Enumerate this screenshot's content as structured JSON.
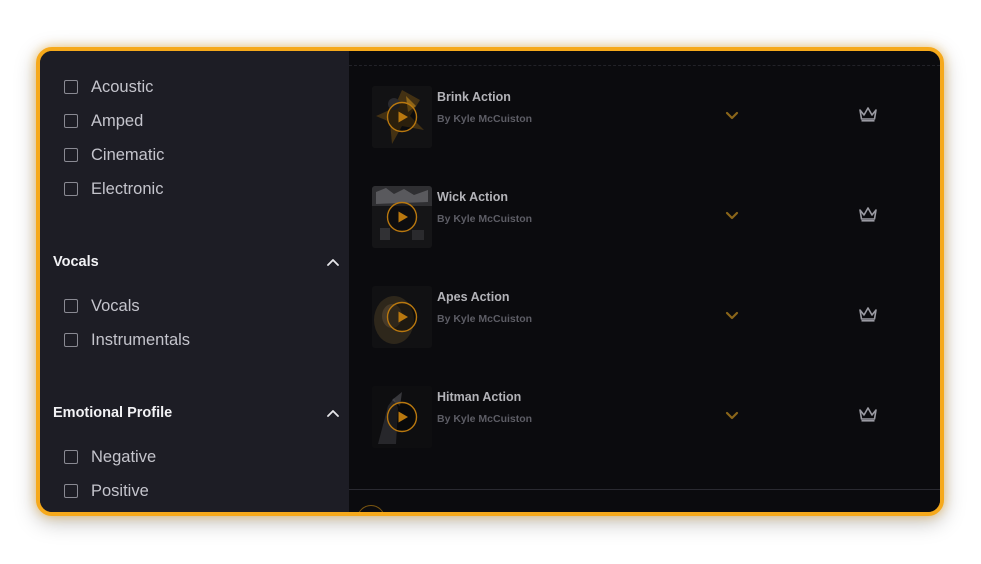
{
  "filters": {
    "mood_items": [
      {
        "label": "Acoustic"
      },
      {
        "label": "Amped"
      },
      {
        "label": "Cinematic"
      },
      {
        "label": "Electronic"
      }
    ],
    "vocals": {
      "title": "Vocals",
      "items": [
        {
          "label": "Vocals"
        },
        {
          "label": "Instrumentals"
        }
      ]
    },
    "emotional_profile": {
      "title": "Emotional Profile",
      "items": [
        {
          "label": "Negative"
        },
        {
          "label": "Positive"
        }
      ]
    }
  },
  "tracks": [
    {
      "title": "Brink Action",
      "artist": "By Kyle McCuiston"
    },
    {
      "title": "Wick Action",
      "artist": "By Kyle McCuiston"
    },
    {
      "title": "Apes Action",
      "artist": "By Kyle McCuiston"
    },
    {
      "title": "Hitman Action",
      "artist": "By Kyle McCuiston"
    }
  ],
  "icons": {
    "checkbox": "checkbox-empty",
    "section_toggle": "chevron-up-icon",
    "play": "play-icon",
    "expand": "chevron-down-icon",
    "premium": "crown-icon"
  },
  "colors": {
    "accent": "#f6a91b",
    "play_ring": "#b9780f",
    "expand_chevron": "#8a6519",
    "crown": "#9a9aa2",
    "sidebar_bg": "#1d1d25",
    "content_bg": "#0b0b0e"
  }
}
